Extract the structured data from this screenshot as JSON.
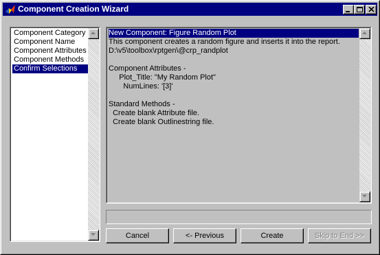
{
  "window": {
    "title": "Component Creation Wizard",
    "title_bar_color": "#000080",
    "app_icon": "matlab-icon",
    "controls": [
      "minimize-icon",
      "maximize-icon",
      "close-icon"
    ]
  },
  "steps": {
    "items": [
      {
        "label": "Component Category"
      },
      {
        "label": "Component Name"
      },
      {
        "label": "Component Attributes"
      },
      {
        "label": "Component Methods"
      },
      {
        "label": "Confirm Selections",
        "selected": true
      }
    ]
  },
  "summary": {
    "lines": [
      "New Component: Figure Random Plot",
      "This component creates a random figure and inserts it into the report.",
      "D:\\v5\\toolbox\\rptgen\\@crp_randplot",
      "",
      "Component Attributes -",
      "     Plot_Title: \"My Random Plot\"",
      "       NumLines: '[3]'",
      "",
      "Standard Methods -",
      "  Create blank Attribute file.",
      "  Create blank Outlinestring file."
    ],
    "selected_line": 0
  },
  "status": {
    "text": ""
  },
  "buttons": {
    "cancel": "Cancel",
    "previous": "<- Previous",
    "create": "Create",
    "skip_to_end": "Skip to End >>"
  },
  "colors": {
    "selection": "#000080",
    "face": "#c0c0c0"
  }
}
